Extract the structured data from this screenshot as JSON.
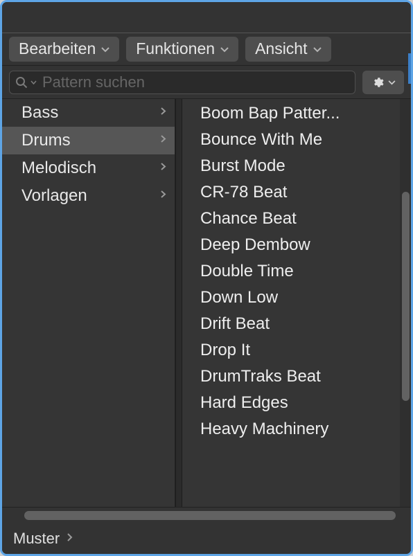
{
  "menus": {
    "edit": "Bearbeiten",
    "functions": "Funktionen",
    "view": "Ansicht"
  },
  "search": {
    "placeholder": "Pattern suchen",
    "value": ""
  },
  "categories": [
    {
      "label": "Bass",
      "selected": false
    },
    {
      "label": "Drums",
      "selected": true
    },
    {
      "label": "Melodisch",
      "selected": false
    },
    {
      "label": "Vorlagen",
      "selected": false
    }
  ],
  "patterns": [
    "Boom Bap Patter...",
    "Bounce With Me",
    "Burst Mode",
    "CR-78 Beat",
    "Chance Beat",
    "Deep Dembow",
    "Double Time",
    "Down Low",
    "Drift Beat",
    "Drop It",
    "DrumTraks Beat",
    "Hard Edges",
    "Heavy Machinery"
  ],
  "breadcrumb": {
    "root": "Muster"
  }
}
